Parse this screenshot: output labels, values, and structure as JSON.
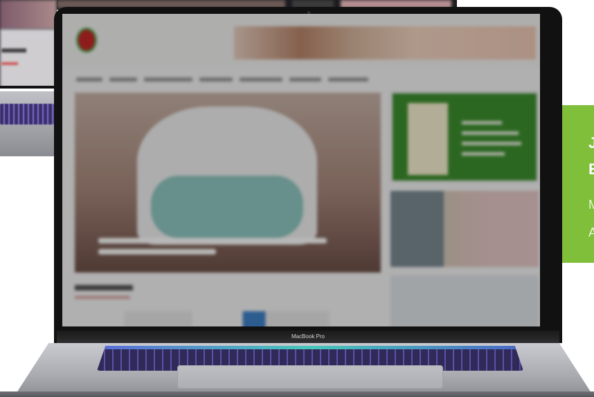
{
  "device": {
    "model_label": "MacBook Pro"
  },
  "promo_card": {
    "color": "#7fbf3a",
    "line1": "J",
    "line2": "E",
    "line3": "M",
    "line4": "A"
  },
  "site": {
    "brand_color": "#c62828",
    "logo_text": "",
    "nav_items": [
      "",
      "",
      "",
      "",
      "",
      "",
      ""
    ]
  }
}
